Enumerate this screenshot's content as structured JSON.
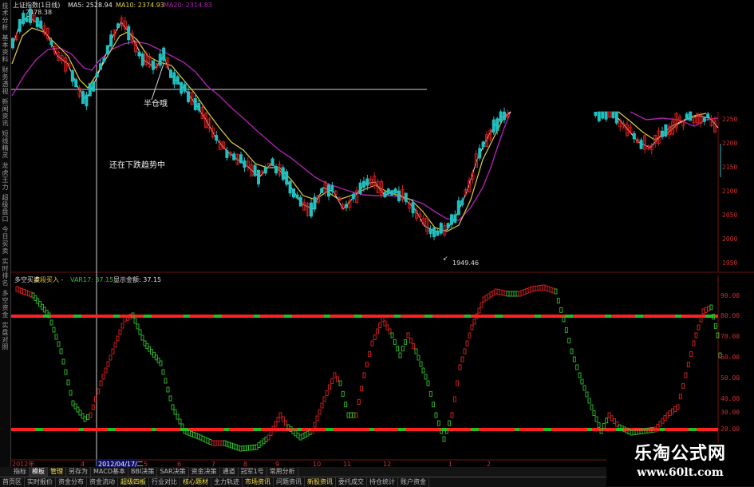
{
  "top_header": {
    "title": "上证指数(1日线)",
    "ma5": "MA5: 2528.94",
    "ma10": "MA10: 2374.93",
    "ma20": "MA20: 2314.83",
    "high_label": "2478.38"
  },
  "left_tabs": [
    "技术分析",
    "基本资料",
    "财务透视",
    "新闻资讯",
    "短线精灵",
    "龙虎王力",
    "超级盘口",
    "今日买卖",
    "实时排名",
    "多空资金",
    "实盘对照"
  ],
  "annotations": {
    "half_position": "半仓哦",
    "downtrend": "还在下跌趋势中",
    "low_label": "1949.46"
  },
  "price_axis": [
    "2250",
    "2200",
    "2150",
    "2100",
    "2050",
    "2000",
    "1950"
  ],
  "osc_header": {
    "name": "多空买卖",
    "signal": "波段买入 -",
    "var17": "VAR17: 37.15",
    "main": "显示金额: 37.15"
  },
  "osc_axis": [
    "90.00",
    "80.00",
    "70.00",
    "60.00",
    "50.00",
    "40.00",
    "30.00",
    "20.00"
  ],
  "date_axis": {
    "year": "2012年",
    "labels": [
      "4",
      "5",
      "6",
      "7",
      "8",
      "9",
      "10",
      "11",
      "12",
      "1",
      "2"
    ],
    "cursor_date": "2012/04/17/二"
  },
  "toolbar_tabs": [
    {
      "label": "指标",
      "state": ""
    },
    {
      "label": "模板",
      "state": "active"
    },
    {
      "label": "管理",
      "state": "hl"
    },
    {
      "label": "另存为",
      "state": ""
    },
    {
      "label": "MACD基本",
      "state": ""
    },
    {
      "label": "BBI决策",
      "state": ""
    },
    {
      "label": "SAR决策",
      "state": ""
    },
    {
      "label": "资金决策",
      "state": ""
    },
    {
      "label": "通道",
      "state": ""
    },
    {
      "label": "冠军1号",
      "state": ""
    },
    {
      "label": "常用分析",
      "state": ""
    }
  ],
  "bottom_tabs": [
    {
      "label": "首页区",
      "state": ""
    },
    {
      "label": "实时报价",
      "state": ""
    },
    {
      "label": "资金分布",
      "state": ""
    },
    {
      "label": "资金流动",
      "state": ""
    },
    {
      "label": "超级四板",
      "state": "hl"
    },
    {
      "label": "行业对比",
      "state": ""
    },
    {
      "label": "核心题材",
      "state": "hl"
    },
    {
      "label": "主力轨迹",
      "state": ""
    },
    {
      "label": "市场资讯",
      "state": "hl"
    },
    {
      "label": "问题资讯",
      "state": ""
    },
    {
      "label": "新股资讯",
      "state": "hl"
    },
    {
      "label": "委托成交",
      "state": ""
    },
    {
      "label": "持仓统计",
      "state": ""
    },
    {
      "label": "账户资金",
      "state": ""
    }
  ],
  "watermark": {
    "brand": "乐淘公式网",
    "url": "www.60lt.com"
  },
  "colors": {
    "up": "#e02020",
    "down": "#20c0c0",
    "ma_white": "#e8e8e8",
    "ma_yellow": "#e0d040",
    "ma_purple": "#b020b0",
    "osc_red": "#e02020",
    "osc_green": "#30c030",
    "level_red": "#ff2020",
    "level_green": "#20c020"
  }
}
